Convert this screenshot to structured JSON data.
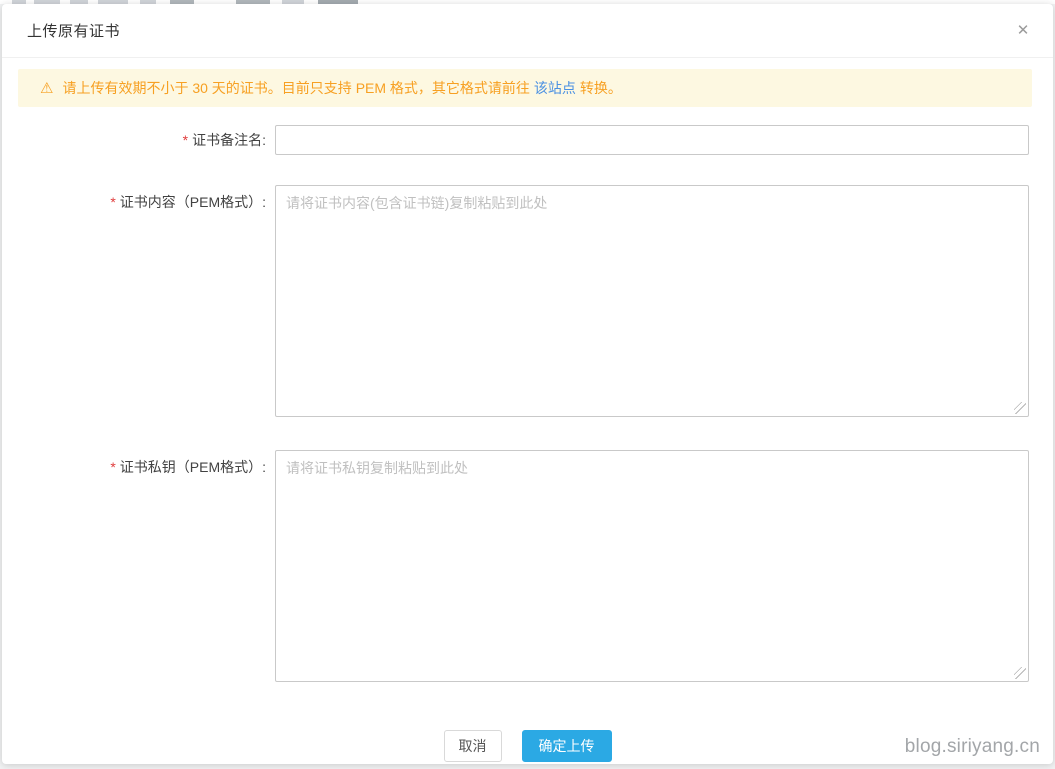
{
  "dialog": {
    "title": "上传原有证书",
    "close_icon": "✕"
  },
  "alert": {
    "icon": "⚠",
    "text_before_link": "请上传有效期不小于 30 天的证书。目前只支持 PEM 格式，其它格式请前往",
    "link_text": "该站点",
    "text_after_link": "转换。"
  },
  "form": {
    "required_marker": "*",
    "fields": [
      {
        "label": "证书备注名:",
        "type": "input",
        "value": "",
        "placeholder": ""
      },
      {
        "label": "证书内容（PEM格式）:",
        "type": "textarea",
        "value": "",
        "placeholder": "请将证书内容(包含证书链)复制粘贴到此处"
      },
      {
        "label": "证书私钥（PEM格式）:",
        "type": "textarea",
        "value": "",
        "placeholder": "请将证书私钥复制粘贴到此处"
      }
    ]
  },
  "footer": {
    "cancel_label": "取消",
    "confirm_label": "确定上传"
  },
  "watermark": "blog.siriyang.cn",
  "colors": {
    "accent_blue": "#2ba9e4",
    "warning_text": "#f7a022",
    "warning_bg": "#fdf8e1",
    "link_blue": "#4a90e2",
    "required_red": "#e03c3c"
  }
}
